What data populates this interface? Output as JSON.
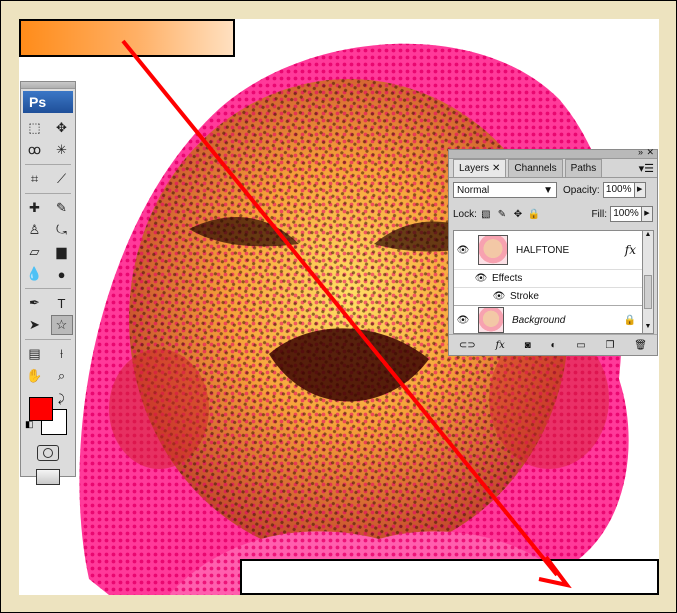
{
  "tools_panel": {
    "logo": "Ps",
    "rows": [
      [
        "marquee-tool-icon",
        "move-tool-icon"
      ],
      [
        "lasso-tool-icon",
        "magic-wand-icon"
      ],
      [
        "crop-tool-icon",
        "slice-tool-icon"
      ],
      [
        "healing-brush-icon",
        "brush-tool-icon"
      ],
      [
        "clone-stamp-icon",
        "history-brush-icon"
      ],
      [
        "eraser-tool-icon",
        "gradient-tool-icon"
      ],
      [
        "blur-tool-icon",
        "dodge-tool-icon"
      ],
      [
        "pen-tool-icon",
        "type-tool-icon"
      ],
      [
        "path-selection-icon",
        "custom-shape-icon"
      ],
      [
        "notes-tool-icon",
        "eyedropper-icon"
      ],
      [
        "hand-tool-icon",
        "zoom-tool-icon"
      ]
    ],
    "foreground_color": "#ff0000",
    "background_color": "#ffffff"
  },
  "layers_panel": {
    "tabs": [
      {
        "label": "Layers",
        "active": true
      },
      {
        "label": "Channels",
        "active": false
      },
      {
        "label": "Paths",
        "active": false
      }
    ],
    "blend_mode": "Normal",
    "opacity_label": "Opacity:",
    "opacity_value": "100%",
    "lock_label": "Lock:",
    "fill_label": "Fill:",
    "fill_value": "100%",
    "layers": [
      {
        "name": "HALFTONE",
        "has_fx": true,
        "fx_label": "fx",
        "effects_label": "Effects",
        "effect": "Stroke"
      },
      {
        "name": "Background",
        "locked": true
      }
    ]
  },
  "colors": {
    "arrow": "#ff0000",
    "swatch_start": "#ff8c1a",
    "swatch_end": "#ffe0c0"
  }
}
